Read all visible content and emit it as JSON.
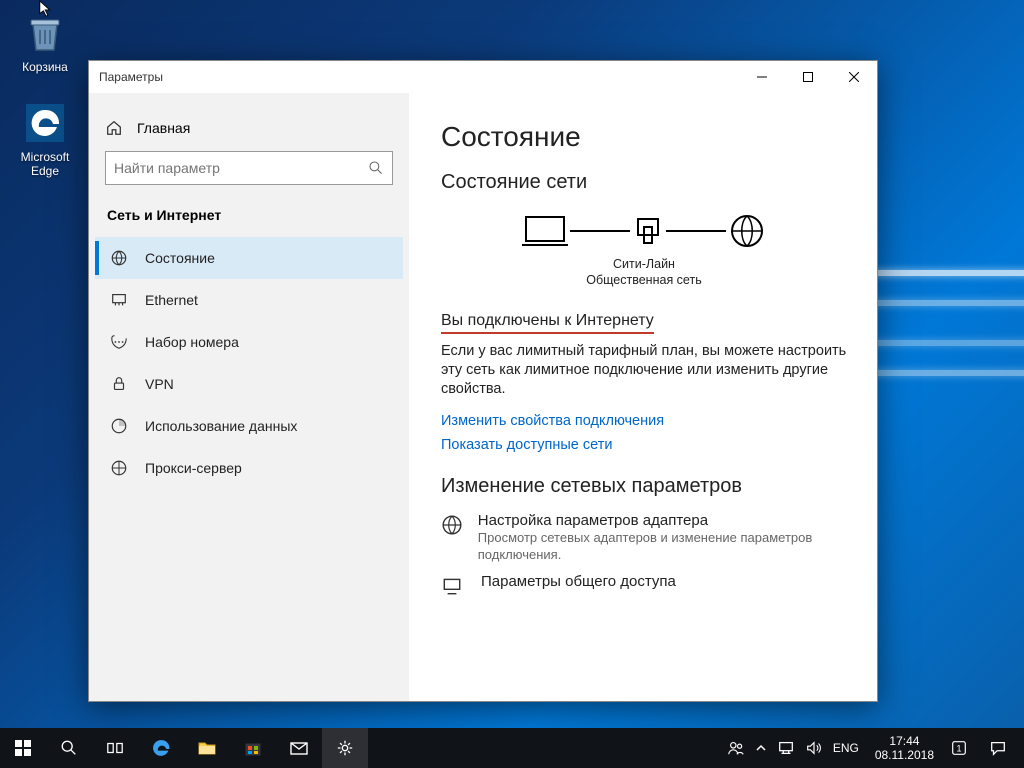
{
  "desktop_icons": {
    "recycle": "Корзина",
    "edge": "Microsoft Edge"
  },
  "window": {
    "title": "Параметры",
    "home": "Главная",
    "search_placeholder": "Найти параметр",
    "category": "Сеть и Интернет",
    "nav": [
      {
        "key": "status",
        "label": "Состояние"
      },
      {
        "key": "ethernet",
        "label": "Ethernet"
      },
      {
        "key": "dialup",
        "label": "Набор номера"
      },
      {
        "key": "vpn",
        "label": "VPN"
      },
      {
        "key": "datausage",
        "label": "Использование данных"
      },
      {
        "key": "proxy",
        "label": "Прокси-сервер"
      }
    ]
  },
  "content": {
    "h1": "Состояние",
    "h2_net": "Состояние сети",
    "net_name": "Сити-Лайн",
    "net_type": "Общественная сеть",
    "connected": "Вы подключены к Интернету",
    "limited_text": "Если у вас лимитный тарифный план, вы можете настроить эту сеть как лимитное подключение или изменить другие свойства.",
    "link_props": "Изменить свойства подключения",
    "link_networks": "Показать доступные сети",
    "h2_change": "Изменение сетевых параметров",
    "opt_adapter_title": "Настройка параметров адаптера",
    "opt_adapter_desc": "Просмотр сетевых адаптеров и изменение параметров подключения.",
    "opt_sharing_title": "Параметры общего доступа"
  },
  "taskbar": {
    "lang": "ENG",
    "time": "17:44",
    "date": "08.11.2018"
  }
}
